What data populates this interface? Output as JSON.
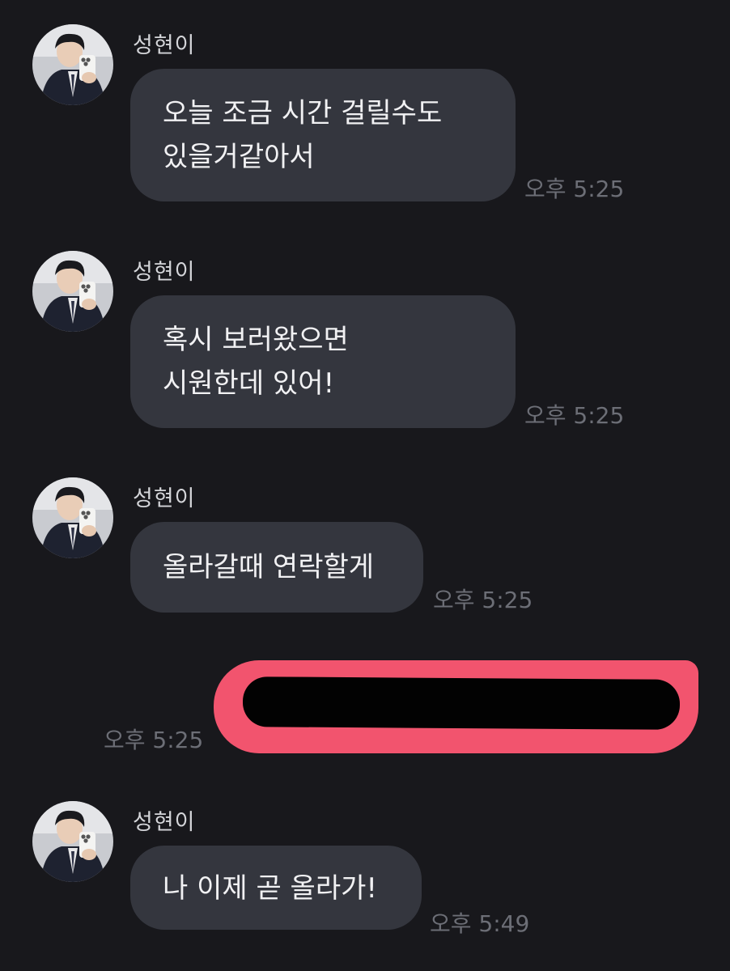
{
  "messages": [
    {
      "sender": "성현이",
      "text": "오늘 조금 시간 걸릴수도\n있을거같아서",
      "time": "오후 5:25"
    },
    {
      "sender": "성현이",
      "text": "혹시 보러왔으면\n시원한데 있어!",
      "time": "오후 5:25"
    },
    {
      "sender": "성현이",
      "text": "올라갈때 연락할게",
      "time": "오후 5:25"
    },
    {
      "sender": "성현이",
      "text": "나 이제 곧 올라가!",
      "time": "오후 5:49"
    }
  ],
  "my_message": {
    "time": "오후 5:25",
    "content": "[redacted]"
  },
  "colors": {
    "background": "#18181c",
    "incoming_bubble": "#34363e",
    "outgoing_bubble": "#f2546e",
    "text": "#f1f1f3",
    "timestamp": "#6c6e76",
    "sender_name": "#d4d5d9"
  },
  "icons": {
    "avatar": "profile-photo-avatar"
  }
}
